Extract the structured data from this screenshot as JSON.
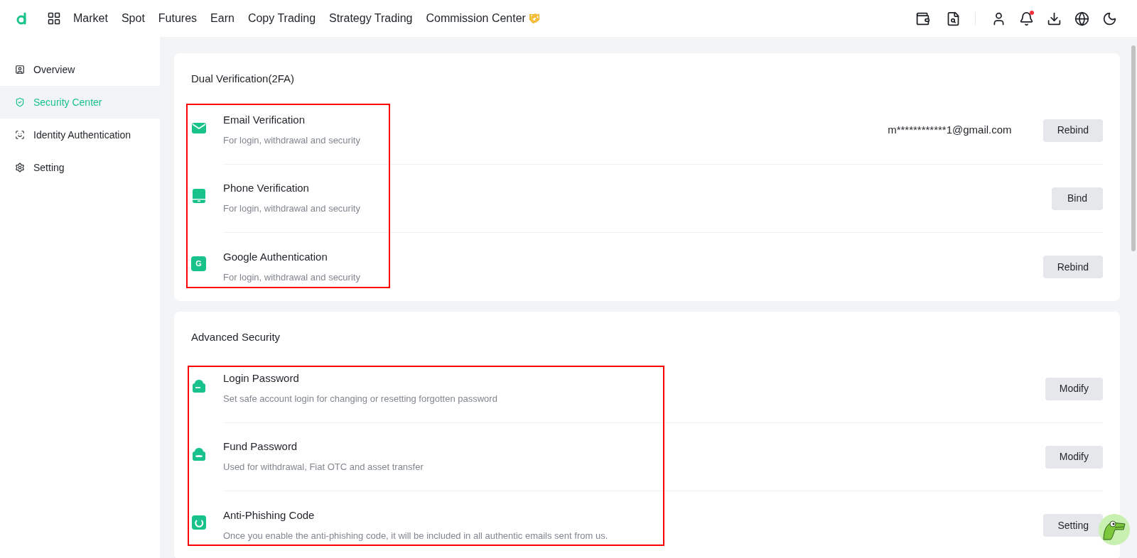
{
  "top_nav": [
    {
      "label": "Market"
    },
    {
      "label": "Spot"
    },
    {
      "label": "Futures"
    },
    {
      "label": "Earn"
    },
    {
      "label": "Copy Trading"
    },
    {
      "label": "Strategy Trading"
    },
    {
      "label": "Commission Center",
      "kind": "with_emoji"
    }
  ],
  "notifications": {
    "unread": true
  },
  "sidebar": {
    "items": [
      {
        "label": "Overview",
        "selected": false
      },
      {
        "label": "Security Center",
        "selected": true
      },
      {
        "label": "Identity Authentication",
        "selected": false
      },
      {
        "label": "Setting",
        "selected": false
      }
    ]
  },
  "sections": [
    {
      "title": "Dual Verification(2FA)",
      "highlighted": true,
      "rows": [
        {
          "kind": "email",
          "title": "Email Verification",
          "description": "For login, withdrawal and security",
          "value": "m************1@gmail.com",
          "button": "Rebind"
        },
        {
          "kind": "phone",
          "title": "Phone Verification",
          "description": "For login, withdrawal and security",
          "button": "Bind"
        },
        {
          "kind": "google",
          "title": "Google Authentication",
          "icon_text": "G",
          "description": "For login, withdrawal and security",
          "button": "Rebind"
        }
      ]
    },
    {
      "title": "Advanced Security",
      "highlighted": true,
      "rows": [
        {
          "kind": "login_lock",
          "title": "Login Password",
          "description": "Set safe account login for changing or resetting forgotten password",
          "button": "Modify"
        },
        {
          "kind": "fund_lock",
          "title": "Fund Password",
          "description": "Used for withdrawal, Fiat OTC and asset transfer",
          "button": "Modify"
        },
        {
          "kind": "phishing",
          "title": "Anti-Phishing Code",
          "description": "Once you enable the anti-phishing code, it will be included in all authentic emails sent from us.",
          "button": "Setting"
        }
      ]
    }
  ]
}
